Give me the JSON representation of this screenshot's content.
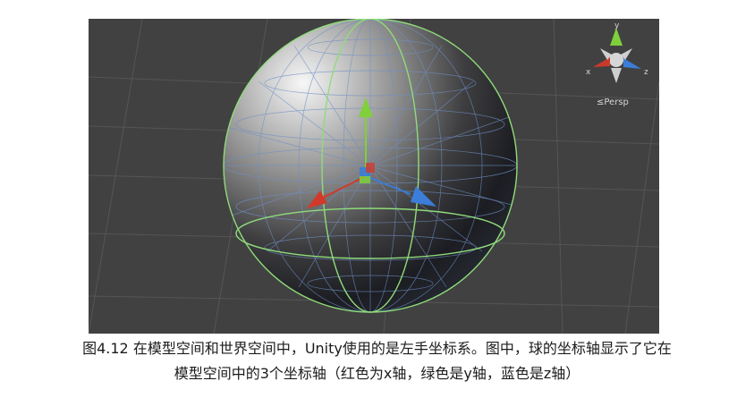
{
  "viewport": {
    "gizmo": {
      "x_label": "x",
      "y_label": "y",
      "z_label": "z"
    },
    "projection_label": "≤Persp"
  },
  "caption": {
    "line1": "图4.12 在模型空间和世界空间中，Unity使用的是左手坐标系。图中，球的坐标轴显示了它在",
    "line2": "模型空间中的3个坐标轴（红色为x轴，绿色是y轴，蓝色是z轴）"
  },
  "colors": {
    "background": "#414141",
    "x_axis": "#d13a2a",
    "y_axis": "#7fd03a",
    "z_axis": "#3b7dd8",
    "collider": "#8fdc7a",
    "wireframe": "#6f8fc4"
  }
}
